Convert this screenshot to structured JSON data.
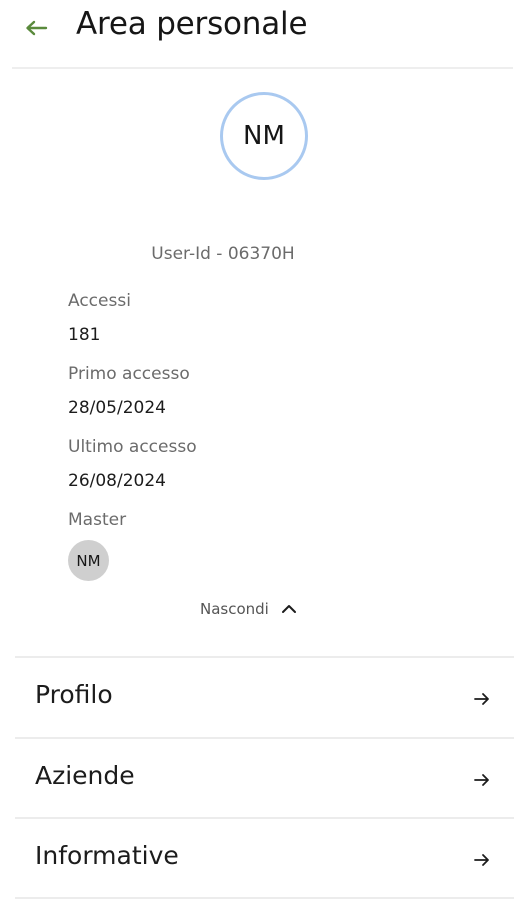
{
  "header": {
    "title": "Area personale",
    "back_icon": "arrow-left-icon",
    "back_icon_color": "#5a8a3c"
  },
  "profile": {
    "initials": "NM",
    "avatar_border_color": "#a9c9f0",
    "user_id": "User-Id - 06370H"
  },
  "details": {
    "accessi_label": "Accessi",
    "accessi_value": "181",
    "primo_label": "Primo accesso",
    "primo_value": "28/05/2024",
    "ultimo_label": "Ultimo accesso",
    "ultimo_value": "26/08/2024",
    "master_label": "Master",
    "master_initials": "NM"
  },
  "toggle": {
    "label": "Nascondi",
    "icon": "chevron-up-icon"
  },
  "menu": {
    "items": [
      {
        "label": "Profilo",
        "icon": "arrow-right-icon"
      },
      {
        "label": "Aziende",
        "icon": "arrow-right-icon"
      },
      {
        "label": "Informative",
        "icon": "arrow-right-icon"
      }
    ]
  }
}
